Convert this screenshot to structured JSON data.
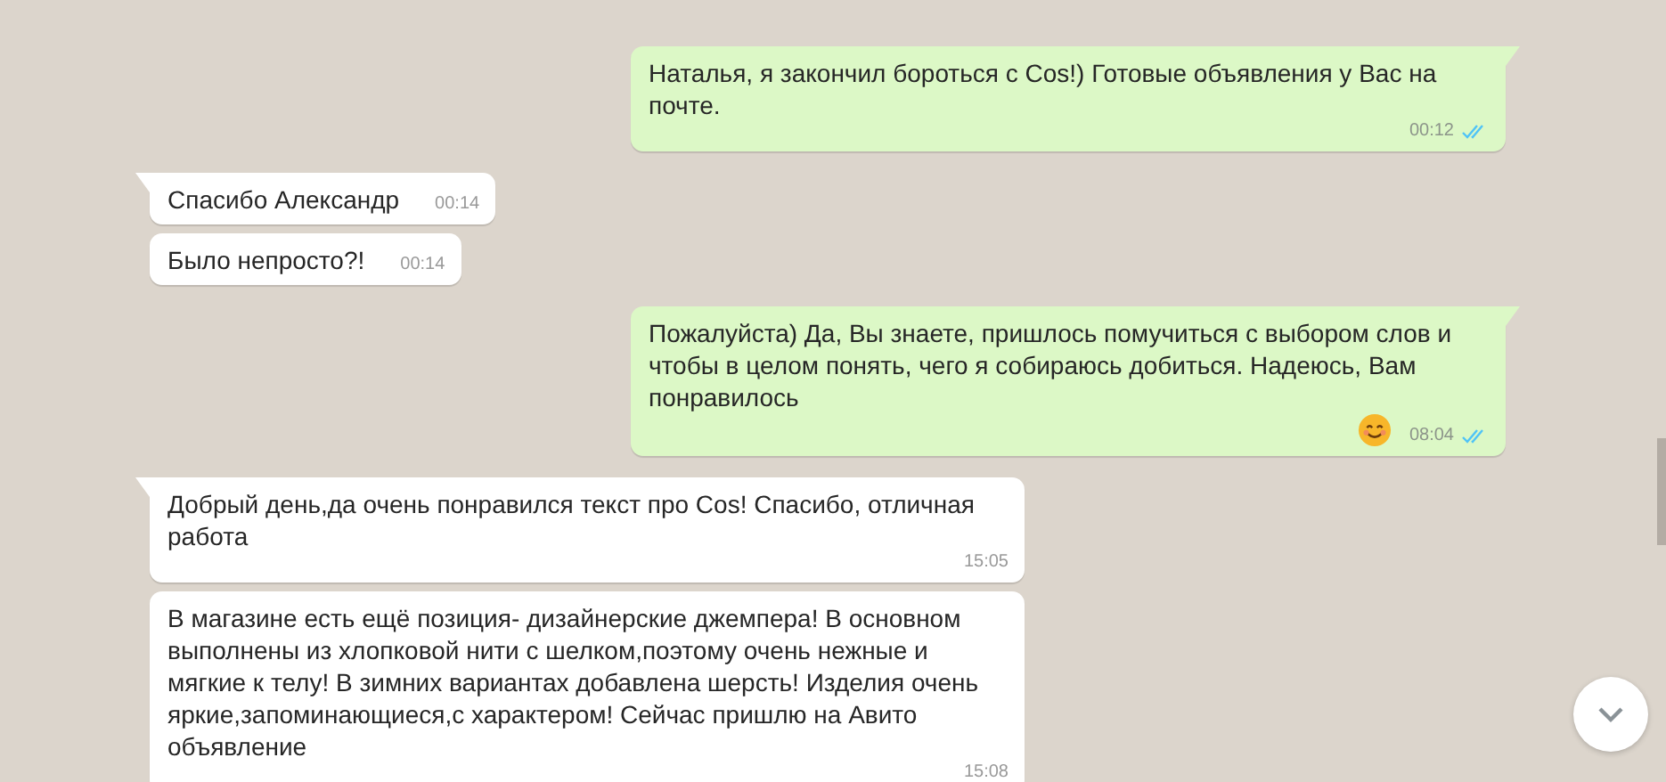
{
  "messages": [
    {
      "outgoing": true,
      "first_in_group": true,
      "text": "Наталья, я закончил бороться с Cos!) Готовые объявления у Вас на почте.",
      "time": "00:12",
      "read": true
    },
    {
      "outgoing": false,
      "first_in_group": true,
      "text": "Спасибо Александр",
      "time": "00:14"
    },
    {
      "outgoing": false,
      "first_in_group": false,
      "text": "Было непросто?!",
      "time": "00:14"
    },
    {
      "outgoing": true,
      "first_in_group": true,
      "text": "Пожалуйста) Да, Вы знаете, пришлось помучиться с выбором слов и чтобы в целом понять, чего я собираюсь добиться. Надеюсь, Вам понравилось",
      "ends_with_smiley": true,
      "time": "08:04",
      "read": true
    },
    {
      "outgoing": false,
      "first_in_group": true,
      "text": "Добрый день,да очень понравился текст про Cos! Спасибо, отличная работа",
      "time": "15:05"
    },
    {
      "outgoing": false,
      "first_in_group": false,
      "text": "В магазине есть ещё позиция- дизайнерские джемпера! В основном выполнены из хлопковой нити с шелком,поэтому очень нежные и мягкие к телу! В зимних вариантах добавлена шерсть! Изделия очень яркие,запоминающиеся,с характером! Сейчас пришлю на Авито объявление",
      "time": "15:08"
    }
  ]
}
